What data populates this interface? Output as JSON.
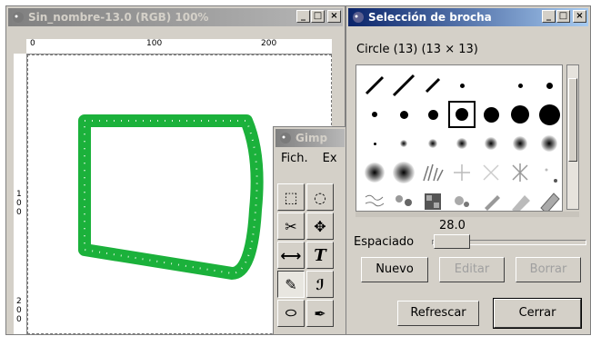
{
  "image_window": {
    "title": "Sin_nombre-13.0 (RGB) 100%",
    "ruler_labels": [
      "0",
      "100",
      "200"
    ],
    "vruler_labels": [
      "1",
      "0",
      "0",
      "2",
      "0",
      "0"
    ],
    "stroke_color": "#1bb13b"
  },
  "toolbox": {
    "title": "Gimp",
    "menu": [
      "Fich.",
      "Ex"
    ],
    "tools": [
      {
        "icon": "rect-select-icon",
        "glyph": "⬚"
      },
      {
        "icon": "ellipse-select-icon",
        "glyph": "◌"
      },
      {
        "icon": "scissors-icon",
        "glyph": "✂"
      },
      {
        "icon": "move-icon",
        "glyph": "✥"
      },
      {
        "icon": "measure-icon",
        "glyph": "⟷"
      },
      {
        "icon": "text-icon",
        "glyph": "T"
      },
      {
        "icon": "pencil-icon",
        "glyph": "✎"
      },
      {
        "icon": "paintbrush-icon",
        "glyph": "🖌"
      },
      {
        "icon": "eraser-icon",
        "glyph": "⬭"
      },
      {
        "icon": "airbrush-icon",
        "glyph": "✒"
      }
    ]
  },
  "brush_dialog": {
    "title": "Selección de brocha",
    "brush_name": "Circle (13)  (13 × 13)",
    "spacing_label": "Espaciado",
    "spacing_value": "28.0",
    "spacing": 28.0,
    "buttons": {
      "new": "Nuevo",
      "edit": "Editar",
      "delete": "Borrar",
      "refresh": "Refrescar",
      "close": "Cerrar"
    }
  }
}
